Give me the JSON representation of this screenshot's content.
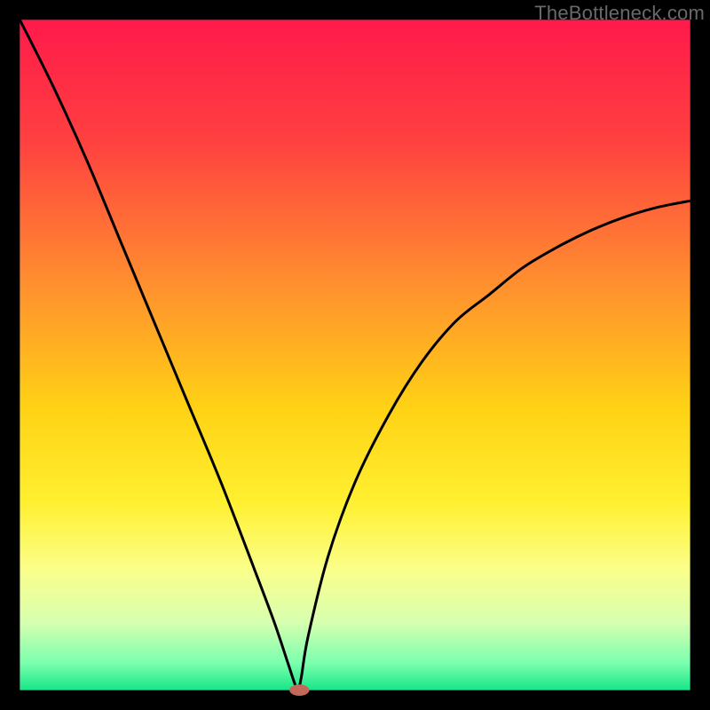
{
  "watermark": "TheBottleneck.com",
  "chart_data": {
    "type": "line",
    "title": "",
    "xlabel": "",
    "ylabel": "",
    "xlim": [
      0,
      100
    ],
    "ylim": [
      0,
      100
    ],
    "background_gradient": {
      "direction": "vertical",
      "stops": [
        {
          "pos": 0.0,
          "color": "#ff1a4b"
        },
        {
          "pos": 0.18,
          "color": "#ff4040"
        },
        {
          "pos": 0.38,
          "color": "#ff8a30"
        },
        {
          "pos": 0.58,
          "color": "#ffd215"
        },
        {
          "pos": 0.72,
          "color": "#fff030"
        },
        {
          "pos": 0.82,
          "color": "#fbff8a"
        },
        {
          "pos": 0.9,
          "color": "#d6ffb0"
        },
        {
          "pos": 0.96,
          "color": "#7affae"
        },
        {
          "pos": 1.0,
          "color": "#18e588"
        }
      ]
    },
    "border": {
      "color": "#000000",
      "width_fraction": 0.028
    },
    "series": [
      {
        "name": "bottleneck-curve",
        "color": "#000000",
        "x": [
          0,
          5,
          10,
          15,
          20,
          25,
          30,
          35,
          38,
          40,
          41,
          41.5,
          42,
          43,
          46,
          50,
          55,
          60,
          65,
          70,
          75,
          80,
          85,
          90,
          95,
          100
        ],
        "y": [
          100,
          90,
          79,
          67,
          55,
          43,
          31,
          18,
          10,
          4,
          1,
          0,
          2,
          8,
          20,
          31,
          41,
          49,
          55,
          59,
          63,
          66,
          68.5,
          70.5,
          72,
          73
        ]
      }
    ],
    "marker": {
      "name": "optimal-point",
      "x": 41.7,
      "y": 0,
      "rx_fraction": 0.014,
      "ry_fraction": 0.008,
      "fill": "#c3695b"
    }
  }
}
